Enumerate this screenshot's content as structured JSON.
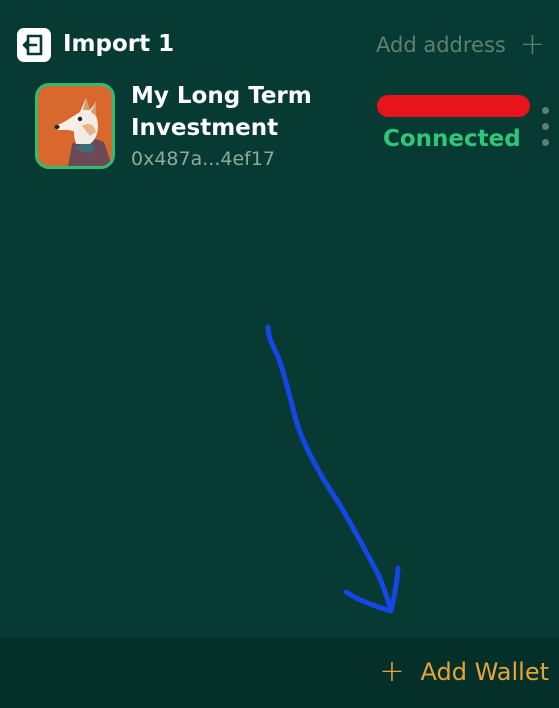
{
  "header": {
    "title": "Import 1",
    "add_address_label": "Add address",
    "add_icon": "plus-icon",
    "import_icon": "import-icon"
  },
  "wallet": {
    "name": "My Long Term Investment",
    "address": "0x487a...4ef17",
    "status": "Connected",
    "avatar_icon": "dog-avatar",
    "menu_icon": "more-vertical-icon"
  },
  "footer": {
    "add_wallet_label": "Add Wallet",
    "add_icon": "plus-icon"
  },
  "colors": {
    "background": "#073a33",
    "footer_background": "#05302a",
    "connected": "#2ec77a",
    "accent": "#e6a33a",
    "muted": "#5e7f78",
    "redaction": "#e8141b",
    "annotation_arrow": "#1447e6"
  }
}
